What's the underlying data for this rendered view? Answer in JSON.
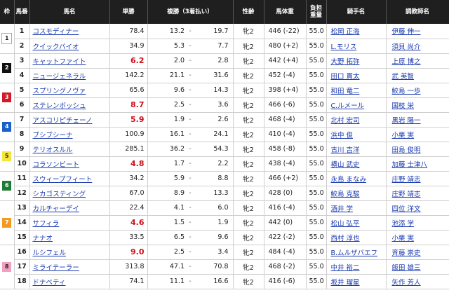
{
  "headers": {
    "waku": "枠",
    "umaban": "馬番",
    "name": "馬名",
    "win": "単勝",
    "place": "複勝（3着払い）",
    "sexage": "性齢",
    "weight": "馬体重",
    "kinryo_l1": "負担",
    "kinryo_l2": "重量",
    "jockey": "騎手名",
    "trainer": "調教師名"
  },
  "waku_groups": [
    {
      "waku": "1",
      "style": "w1",
      "rows": 2
    },
    {
      "waku": "2",
      "style": "w2",
      "rows": 2
    },
    {
      "waku": "3",
      "style": "w3",
      "rows": 2
    },
    {
      "waku": "4",
      "style": "w4",
      "rows": 2
    },
    {
      "waku": "5",
      "style": "w5",
      "rows": 2
    },
    {
      "waku": "6",
      "style": "w6",
      "rows": 2
    },
    {
      "waku": "7",
      "style": "w7",
      "rows": 3
    },
    {
      "waku": "8",
      "style": "w8",
      "rows": 3
    }
  ],
  "accent_color": "#d0101c",
  "horses": [
    {
      "num": "1",
      "name": "コスモディナー",
      "win": "78.4",
      "plow": "13.2",
      "dash": "-",
      "phigh": "19.7",
      "sexage": "牝2",
      "weight": "446 (-22)",
      "kinryo": "55.0",
      "jockey": "松岡 正海",
      "trainer": "伊藤 伸一",
      "hot": false
    },
    {
      "num": "2",
      "name": "クイックバイオ",
      "win": "34.9",
      "plow": "5.3",
      "dash": "-",
      "phigh": "7.7",
      "sexage": "牝2",
      "weight": "480 (+2)",
      "kinryo": "55.0",
      "jockey": "L.モリス",
      "trainer": "須貝 尚介",
      "hot": false
    },
    {
      "num": "3",
      "name": "キャットファイト",
      "win": "6.2",
      "plow": "2.0",
      "dash": "-",
      "phigh": "2.8",
      "sexage": "牝2",
      "weight": "442 (+4)",
      "kinryo": "55.0",
      "jockey": "大野 拓弥",
      "trainer": "上原 博之",
      "hot": true
    },
    {
      "num": "4",
      "name": "ニュージェネラル",
      "win": "142.2",
      "plow": "21.1",
      "dash": "-",
      "phigh": "31.6",
      "sexage": "牝2",
      "weight": "452 (-4)",
      "kinryo": "55.0",
      "jockey": "田口 貫太",
      "trainer": "武 英智",
      "hot": false
    },
    {
      "num": "5",
      "name": "スプリングノヴァ",
      "win": "65.6",
      "plow": "9.6",
      "dash": "-",
      "phigh": "14.3",
      "sexage": "牝2",
      "weight": "398 (+4)",
      "kinryo": "55.0",
      "jockey": "和田 竜二",
      "trainer": "鮫島 一歩",
      "hot": false
    },
    {
      "num": "6",
      "name": "ステレンボッシュ",
      "win": "8.7",
      "plow": "2.5",
      "dash": "-",
      "phigh": "3.6",
      "sexage": "牝2",
      "weight": "466 (-6)",
      "kinryo": "55.0",
      "jockey": "C.ルメール",
      "trainer": "国枝 栄",
      "hot": true
    },
    {
      "num": "7",
      "name": "アスコリピチェーノ",
      "win": "5.9",
      "plow": "1.9",
      "dash": "-",
      "phigh": "2.6",
      "sexage": "牝2",
      "weight": "468 (-4)",
      "kinryo": "55.0",
      "jockey": "北村 宏司",
      "trainer": "黒岩 陽一",
      "hot": true
    },
    {
      "num": "8",
      "name": "ブシブシーナ",
      "win": "100.9",
      "plow": "16.1",
      "dash": "-",
      "phigh": "24.1",
      "sexage": "牝2",
      "weight": "410 (-4)",
      "kinryo": "55.0",
      "jockey": "浜中 俊",
      "trainer": "小栗 実",
      "hot": false
    },
    {
      "num": "9",
      "name": "テリオスルル",
      "win": "285.1",
      "plow": "36.2",
      "dash": "-",
      "phigh": "54.3",
      "sexage": "牝2",
      "weight": "458 (-8)",
      "kinryo": "55.0",
      "jockey": "古川 吉洋",
      "trainer": "田島 俊明",
      "hot": false
    },
    {
      "num": "10",
      "name": "コラソンビート",
      "win": "4.8",
      "plow": "1.7",
      "dash": "-",
      "phigh": "2.2",
      "sexage": "牝2",
      "weight": "438 (-4)",
      "kinryo": "55.0",
      "jockey": "横山 武史",
      "trainer": "加藤 士津八",
      "hot": true
    },
    {
      "num": "11",
      "name": "スウィープフィート",
      "win": "34.2",
      "plow": "5.9",
      "dash": "-",
      "phigh": "8.8",
      "sexage": "牝2",
      "weight": "466 (+2)",
      "kinryo": "55.0",
      "jockey": "永島 まなみ",
      "trainer": "庄野 靖志",
      "hot": false
    },
    {
      "num": "12",
      "name": "シカゴスティング",
      "win": "67.0",
      "plow": "8.9",
      "dash": "-",
      "phigh": "13.3",
      "sexage": "牝2",
      "weight": "428 (0)",
      "kinryo": "55.0",
      "jockey": "鮫島 克駿",
      "trainer": "庄野 靖志",
      "hot": false
    },
    {
      "num": "13",
      "name": "カルチャーデイ",
      "win": "22.4",
      "plow": "4.1",
      "dash": "-",
      "phigh": "6.0",
      "sexage": "牝2",
      "weight": "416 (-4)",
      "kinryo": "55.0",
      "jockey": "酒井 学",
      "trainer": "四位 洋文",
      "hot": false
    },
    {
      "num": "14",
      "name": "サフィラ",
      "win": "4.6",
      "plow": "1.5",
      "dash": "-",
      "phigh": "1.9",
      "sexage": "牝2",
      "weight": "442 (0)",
      "kinryo": "55.0",
      "jockey": "松山 弘平",
      "trainer": "池添 学",
      "hot": true
    },
    {
      "num": "15",
      "name": "ナナオ",
      "win": "33.5",
      "plow": "6.5",
      "dash": "-",
      "phigh": "9.6",
      "sexage": "牝2",
      "weight": "422 (-2)",
      "kinryo": "55.0",
      "jockey": "西村 淳也",
      "trainer": "小栗 実",
      "hot": false
    },
    {
      "num": "16",
      "name": "ルシフェル",
      "win": "9.0",
      "plow": "2.5",
      "dash": "-",
      "phigh": "3.4",
      "sexage": "牝2",
      "weight": "484 (-4)",
      "kinryo": "55.0",
      "jockey": "B.ムルザバエフ",
      "trainer": "斉藤 崇史",
      "hot": true
    },
    {
      "num": "17",
      "name": "ミライテーラー",
      "win": "313.8",
      "plow": "47.1",
      "dash": "-",
      "phigh": "70.8",
      "sexage": "牝2",
      "weight": "468 (-2)",
      "kinryo": "55.0",
      "jockey": "中井 裕二",
      "trainer": "飯田 雄三",
      "hot": false
    },
    {
      "num": "18",
      "name": "ドナベティ",
      "win": "74.1",
      "plow": "11.1",
      "dash": "-",
      "phigh": "16.6",
      "sexage": "牝2",
      "weight": "416 (-6)",
      "kinryo": "55.0",
      "jockey": "坂井 瑠星",
      "trainer": "矢作 芳人",
      "hot": false
    }
  ]
}
